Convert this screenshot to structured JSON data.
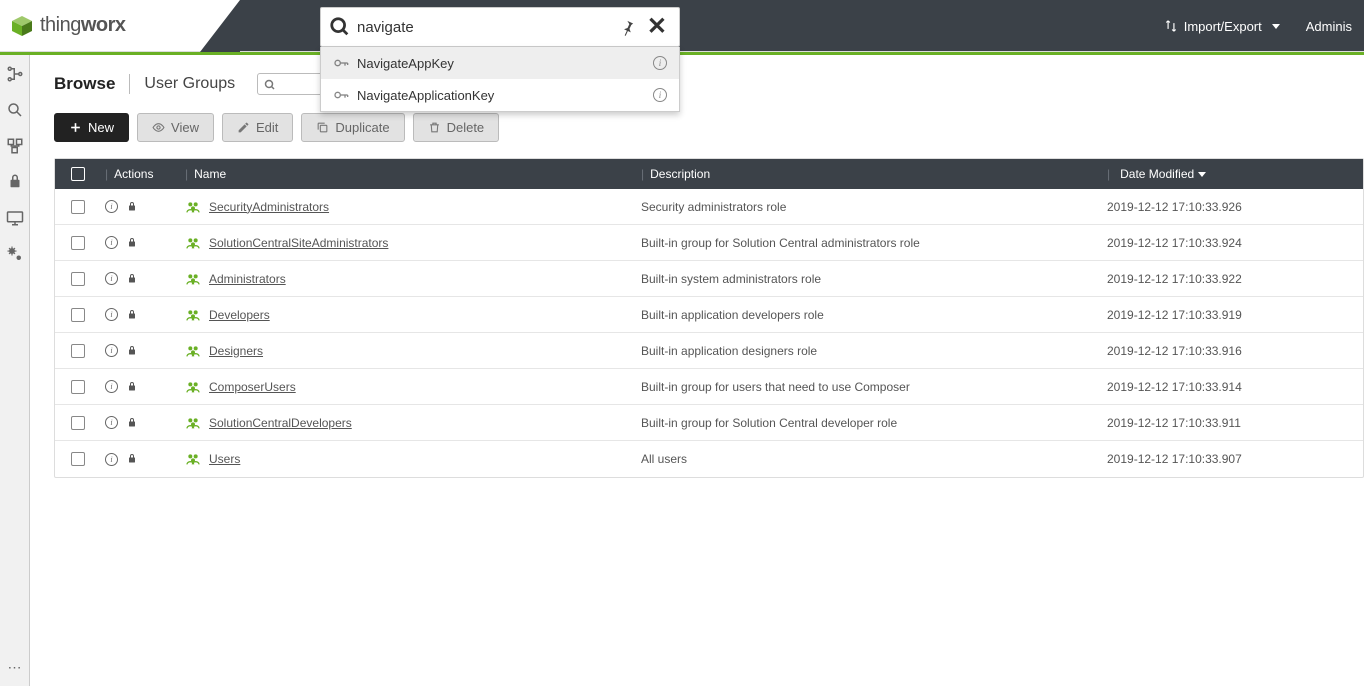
{
  "logo": {
    "brand_a": "thing",
    "brand_b": "worx"
  },
  "global_search": {
    "value": "navigate",
    "suggestions": [
      {
        "label": "NavigateAppKey",
        "highlight": true
      },
      {
        "label": "NavigateApplicationKey",
        "highlight": false
      }
    ]
  },
  "header": {
    "import_export": "Import/Export",
    "user_label": "Adminis"
  },
  "breadcrumb": {
    "browse": "Browse",
    "current": "User Groups"
  },
  "toolbar": {
    "new_label": "New",
    "view_label": "View",
    "edit_label": "Edit",
    "duplicate_label": "Duplicate",
    "delete_label": "Delete"
  },
  "table": {
    "headers": {
      "actions": "Actions",
      "name": "Name",
      "description": "Description",
      "date_modified": "Date Modified"
    },
    "rows": [
      {
        "name": "SecurityAdministrators",
        "description": "Security administrators role",
        "date": "2019-12-12 17:10:33.926"
      },
      {
        "name": "SolutionCentralSiteAdministrators",
        "description": "Built-in group for Solution Central administrators role",
        "date": "2019-12-12 17:10:33.924"
      },
      {
        "name": "Administrators",
        "description": "Built-in system administrators role",
        "date": "2019-12-12 17:10:33.922"
      },
      {
        "name": "Developers",
        "description": "Built-in application developers role",
        "date": "2019-12-12 17:10:33.919"
      },
      {
        "name": "Designers",
        "description": "Built-in application designers role",
        "date": "2019-12-12 17:10:33.916"
      },
      {
        "name": "ComposerUsers",
        "description": "Built-in group for users that need to use Composer",
        "date": "2019-12-12 17:10:33.914"
      },
      {
        "name": "SolutionCentralDevelopers",
        "description": "Built-in group for Solution Central developer role",
        "date": "2019-12-12 17:10:33.911"
      },
      {
        "name": "Users",
        "description": "All users",
        "date": "2019-12-12 17:10:33.907"
      }
    ]
  }
}
